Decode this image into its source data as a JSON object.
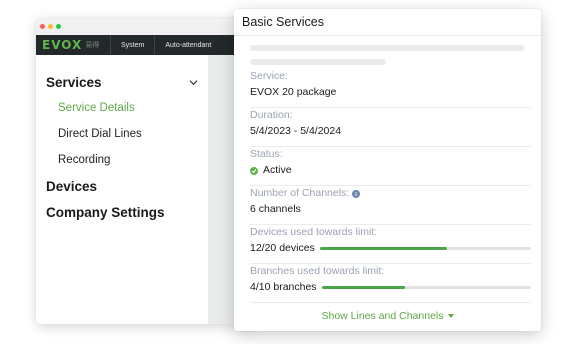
{
  "colors": {
    "accent": "#5fa847",
    "progress": "#4aa44a",
    "appbar": "#23292a",
    "label": "#9aa3b1",
    "traffic_red": "#ff5f57",
    "traffic_yellow": "#febc2e",
    "traffic_green": "#28c840"
  },
  "app": {
    "logo": "EVOX",
    "logo_sub": "易得",
    "nav": [
      "System",
      "Auto-attendant"
    ]
  },
  "sidebar": {
    "groups": [
      {
        "label": "Services",
        "expanded": true,
        "items": [
          {
            "label": "Service Details",
            "active": true
          },
          {
            "label": "Direct Dial Lines",
            "active": false
          },
          {
            "label": "Recording",
            "active": false
          }
        ]
      },
      {
        "label": "Devices"
      },
      {
        "label": "Company Settings"
      }
    ]
  },
  "card": {
    "title": "Basic Services",
    "fields": [
      {
        "label": "Service:",
        "value": "EVOX 20 package"
      },
      {
        "label": "Duration:",
        "value": "5/4/2023 - 5/4/2024"
      },
      {
        "label": "Status:",
        "value": "Active"
      },
      {
        "label": "Number of Channels:",
        "value": "6 channels"
      },
      {
        "label": "Devices used towards limit:",
        "value": "12/20 devices",
        "progress": 0.6
      },
      {
        "label": "Branches used towards limit:",
        "value": "4/10 branches",
        "progress": 0.4
      }
    ],
    "footer_link": "Show Lines and Channels"
  }
}
